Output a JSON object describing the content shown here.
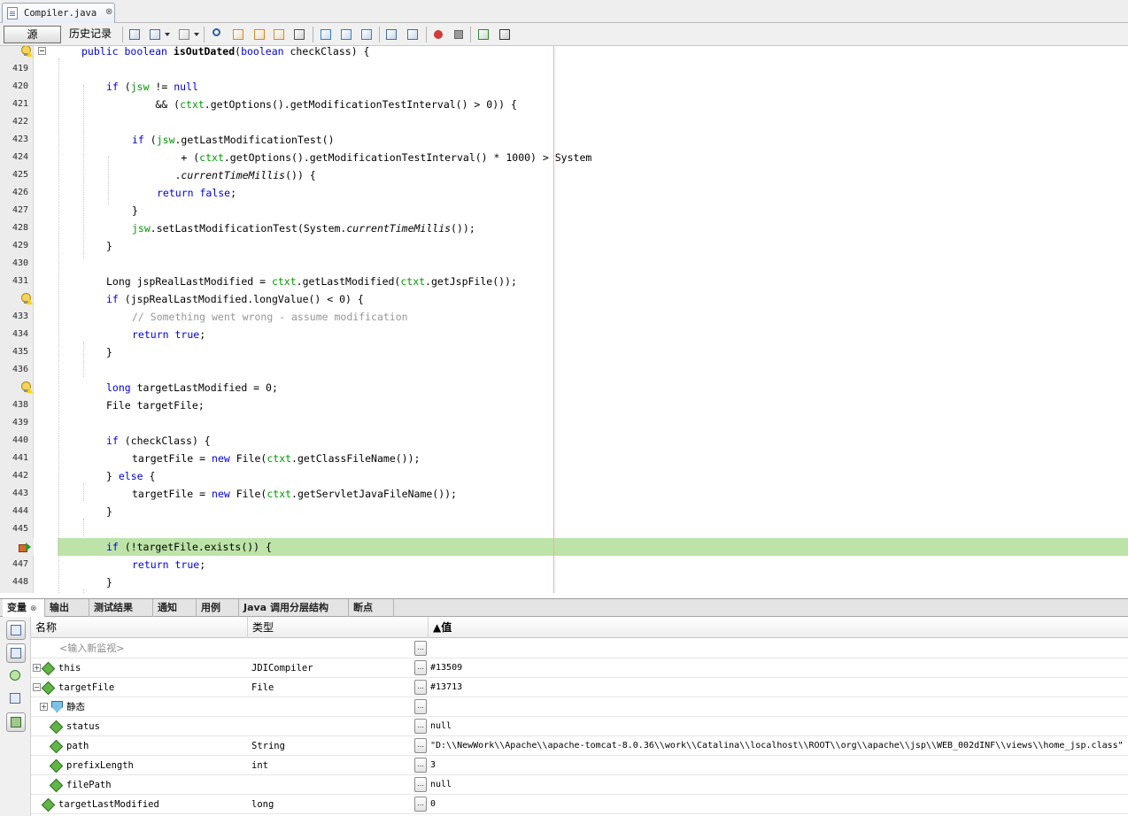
{
  "file_tab": {
    "name": "Compiler.java",
    "close": "⊗"
  },
  "toolbar": {
    "source_label": "源",
    "history_label": "历史记录",
    "icons": [
      "go-to-last-edit-icon",
      "back-icon",
      "forward-icon",
      "find-icon",
      "find-previous-icon",
      "find-next-icon",
      "toggle-highlight-icon",
      "toggle-rect-select-icon",
      "previous-bookmark-icon",
      "next-bookmark-icon",
      "toggle-bookmark-icon",
      "shift-left-icon",
      "shift-right-icon",
      "start-macro-icon",
      "stop-macro-icon",
      "comment-icon",
      "uncomment-icon"
    ]
  },
  "editor": {
    "lines": [
      {
        "num": "",
        "marker": "bulb",
        "fold": true,
        "indent": 0,
        "code": "public boolean isOutDated(boolean checkClass) {"
      },
      {
        "num": "419",
        "indent": 1,
        "code": ""
      },
      {
        "num": "420",
        "indent": 1,
        "code": "if (jsw != null"
      },
      {
        "num": "421",
        "indent": 1,
        "code": "        && (ctxt.getOptions().getModificationTestInterval() > 0)) {"
      },
      {
        "num": "422",
        "indent": 1,
        "code": ""
      },
      {
        "num": "423",
        "indent": 2,
        "code": "if (jsw.getLastModificationTest()"
      },
      {
        "num": "424",
        "indent": 2,
        "code": "        + (ctxt.getOptions().getModificationTestInterval() * 1000) > System"
      },
      {
        "num": "425",
        "indent": 2,
        "code": "       .currentTimeMillis()) {"
      },
      {
        "num": "426",
        "indent": 3,
        "code": "return false;"
      },
      {
        "num": "427",
        "indent": 2,
        "code": "}"
      },
      {
        "num": "428",
        "indent": 2,
        "code": "jsw.setLastModificationTest(System.currentTimeMillis());"
      },
      {
        "num": "429",
        "indent": 1,
        "code": "}"
      },
      {
        "num": "430",
        "indent": 1,
        "code": ""
      },
      {
        "num": "431",
        "indent": 1,
        "code": "Long jspRealLastModified = ctxt.getLastModified(ctxt.getJspFile());"
      },
      {
        "num": "",
        "marker": "bulb",
        "indent": 1,
        "code": "if (jspRealLastModified.longValue() < 0) {"
      },
      {
        "num": "433",
        "indent": 2,
        "code": "// Something went wrong - assume modification"
      },
      {
        "num": "434",
        "indent": 2,
        "code": "return true;"
      },
      {
        "num": "435",
        "indent": 1,
        "code": "}"
      },
      {
        "num": "436",
        "indent": 1,
        "code": ""
      },
      {
        "num": "",
        "marker": "bulb",
        "indent": 1,
        "code": "long targetLastModified = 0;"
      },
      {
        "num": "438",
        "indent": 1,
        "code": "File targetFile;"
      },
      {
        "num": "439",
        "indent": 1,
        "code": ""
      },
      {
        "num": "440",
        "indent": 1,
        "code": "if (checkClass) {"
      },
      {
        "num": "441",
        "indent": 2,
        "code": "targetFile = new File(ctxt.getClassFileName());"
      },
      {
        "num": "442",
        "indent": 1,
        "code": "} else {"
      },
      {
        "num": "443",
        "indent": 2,
        "code": "targetFile = new File(ctxt.getServletJavaFileName());"
      },
      {
        "num": "444",
        "indent": 1,
        "code": "}"
      },
      {
        "num": "445",
        "indent": 1,
        "code": ""
      },
      {
        "num": "",
        "marker": "pc",
        "highlight": true,
        "indent": 1,
        "code": "if (!targetFile.exists()) {"
      },
      {
        "num": "447",
        "indent": 2,
        "code": "return true;"
      },
      {
        "num": "448",
        "indent": 1,
        "code": "}"
      }
    ]
  },
  "bottom_tabs": [
    "变量",
    "输出",
    "测试结果",
    "通知",
    "用例",
    "Java 调用分层结构",
    "断点"
  ],
  "variables": {
    "columns": {
      "name": "名称",
      "type": "类型",
      "value": "▲值"
    },
    "new_watch_placeholder": "<输入新监视>",
    "rows": [
      {
        "level": 0,
        "expander": "+",
        "icon": "field-icon",
        "name": "this",
        "type": "JDICompiler",
        "value": "#13509"
      },
      {
        "level": 0,
        "expander": "−",
        "icon": "field-icon",
        "name": "targetFile",
        "type": "File",
        "value": "#13713"
      },
      {
        "level": 1,
        "expander": "+",
        "icon": "static-icon",
        "name": "静态",
        "type": "",
        "value": ""
      },
      {
        "level": 1,
        "expander": "",
        "icon": "field-icon",
        "name": "status",
        "type": "",
        "value": "null"
      },
      {
        "level": 1,
        "expander": "",
        "icon": "field-icon",
        "name": "path",
        "type": "String",
        "value": "\"D:\\\\NewWork\\\\Apache\\\\apache-tomcat-8.0.36\\\\work\\\\Catalina\\\\localhost\\\\ROOT\\\\org\\\\apache\\\\jsp\\\\WEB_002dINF\\\\views\\\\home_jsp.class\""
      },
      {
        "level": 1,
        "expander": "",
        "icon": "field-icon",
        "name": "prefixLength",
        "type": "int",
        "value": "3"
      },
      {
        "level": 1,
        "expander": "",
        "icon": "field-icon",
        "name": "filePath",
        "type": "",
        "value": "null"
      },
      {
        "level": 0,
        "expander": "",
        "icon": "field-icon",
        "name": "targetLastModified",
        "type": "long",
        "value": "0"
      }
    ]
  }
}
